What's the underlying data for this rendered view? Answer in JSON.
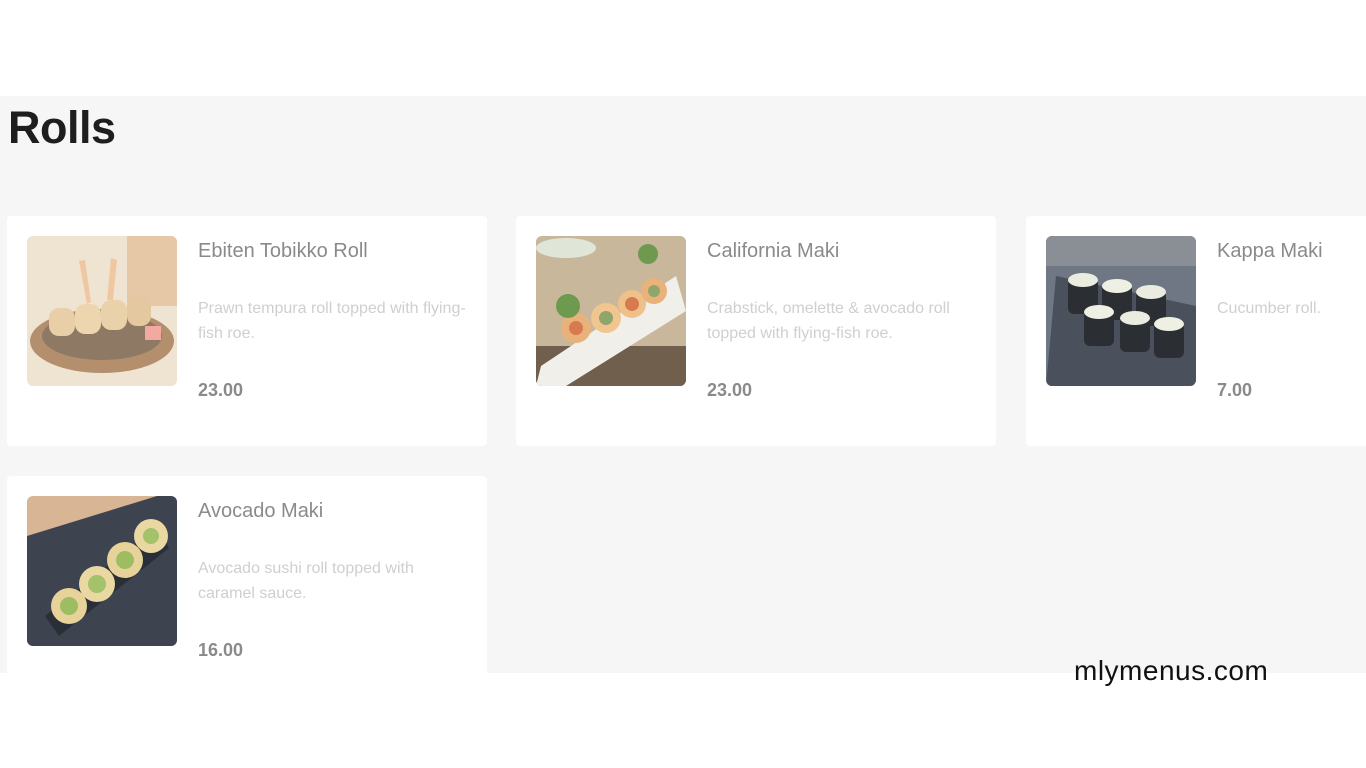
{
  "section": {
    "title": "Rolls"
  },
  "items": [
    {
      "name": "Ebiten Tobikko Roll",
      "description": "Prawn tempura roll topped with flying-fish roe.",
      "price": "23.00"
    },
    {
      "name": "California Maki",
      "description": "Crabstick, omelette & avocado roll topped with flying-fish roe.",
      "price": "23.00"
    },
    {
      "name": "Kappa Maki",
      "description": "Cucumber roll.",
      "price": "7.00"
    },
    {
      "name": "Avocado Maki",
      "description": "Avocado sushi roll topped with caramel sauce.",
      "price": "16.00"
    }
  ],
  "footer": {
    "watermark": "mlymenus.com"
  }
}
